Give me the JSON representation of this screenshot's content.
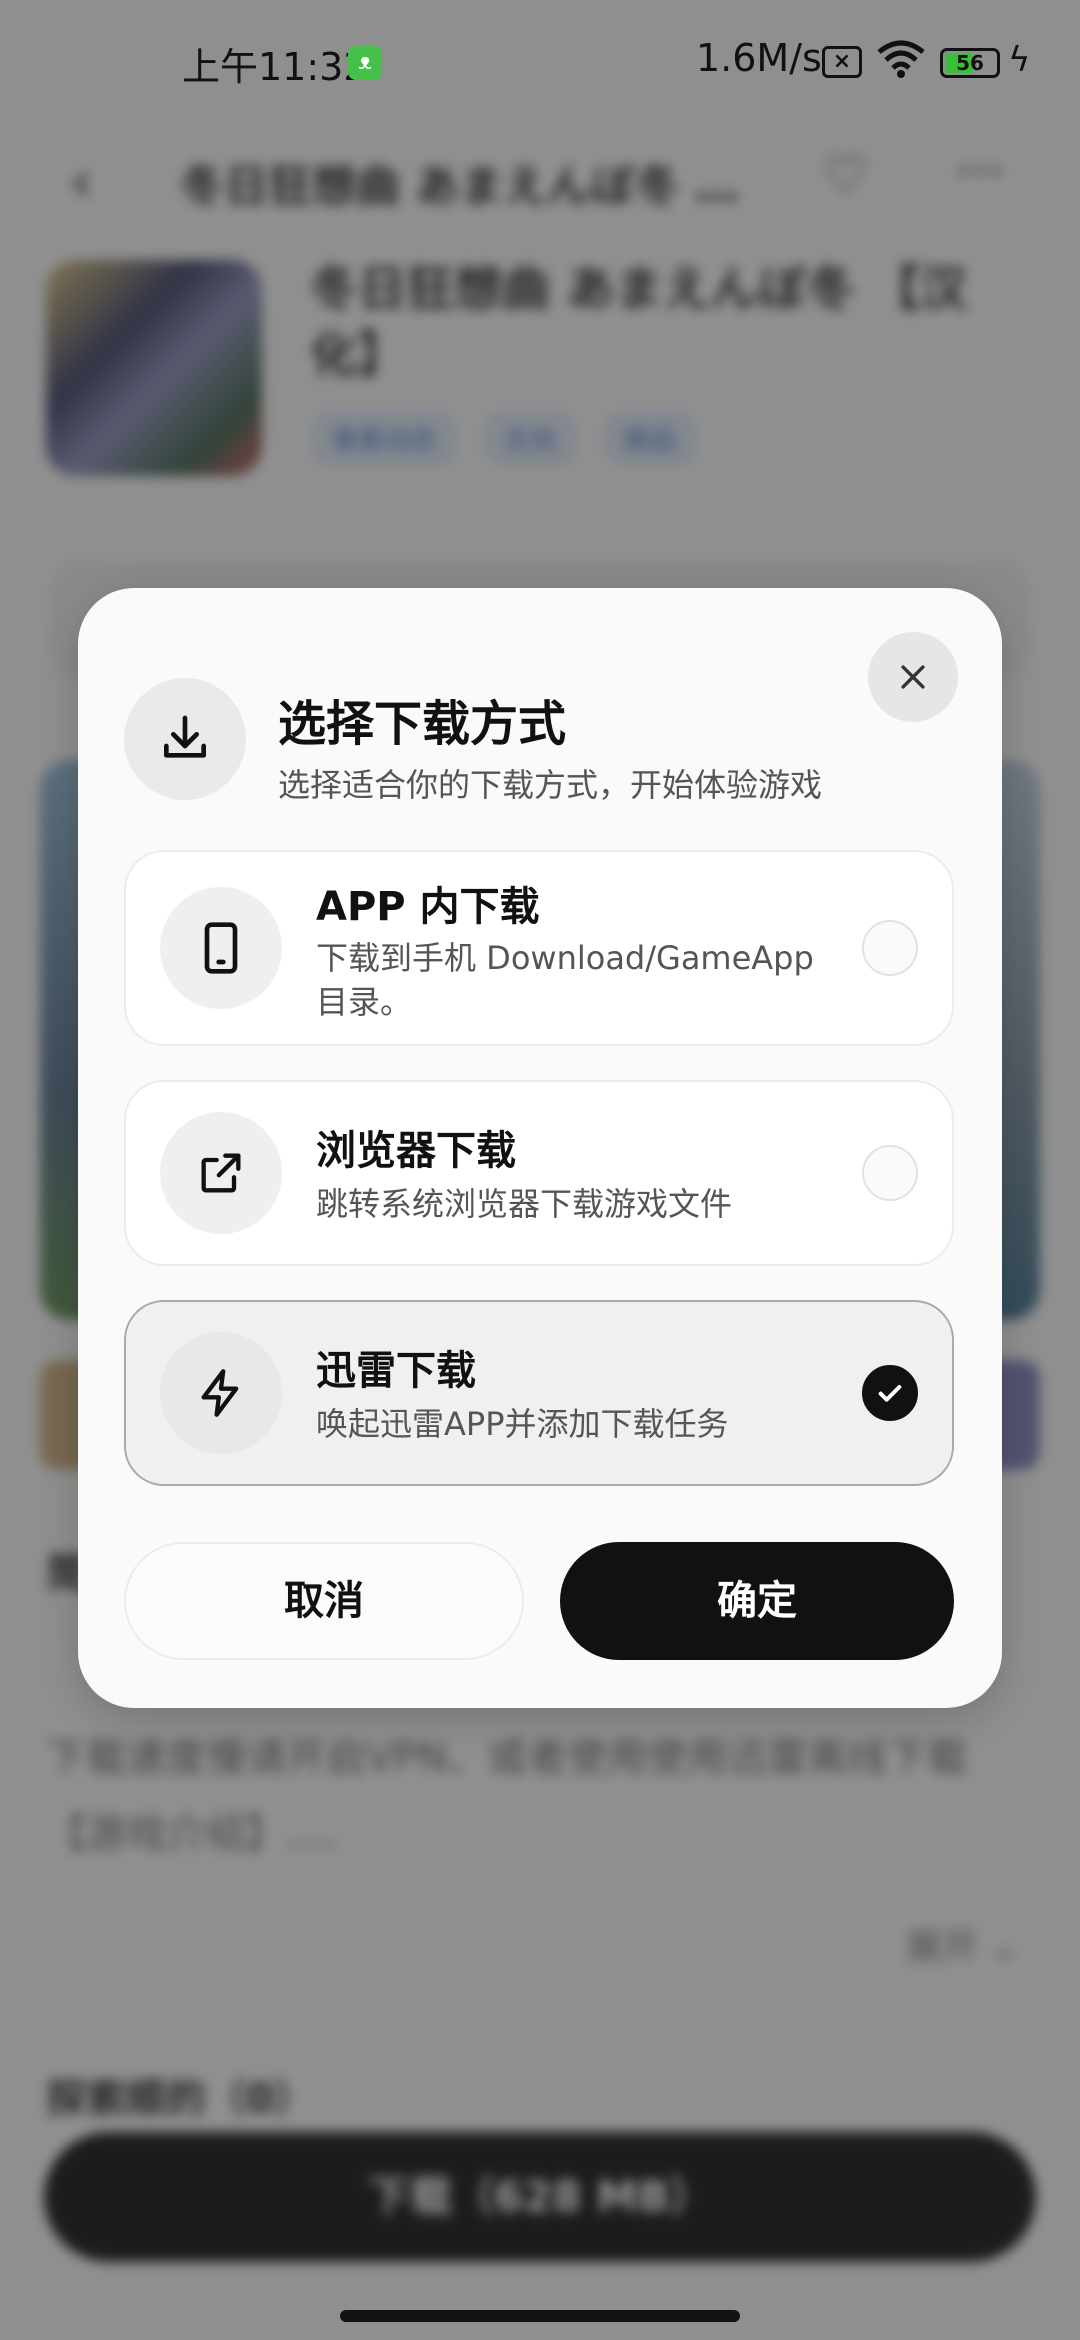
{
  "status_bar": {
    "time": "上午11:32",
    "net_speed": "1.6M/s",
    "battery_level": "56",
    "battery_percent": 56,
    "icons": [
      "cat-app-icon",
      "sim-x-icon",
      "wifi-icon",
      "battery-icon",
      "charging-icon"
    ]
  },
  "background": {
    "nav_title": "冬日狂想曲 あまえんぼ冬 …",
    "game_title": "冬日狂想曲 あまえんぼ冬 【汉化】",
    "tags": [
      "像素动态",
      "文向",
      "精品"
    ],
    "section_title": "简",
    "description": "下载速度慢请开启VPN、或者使用使用迅雷离线下载【游戏介绍】....",
    "expand_label": "展开",
    "related_title": "探索顺的（0）",
    "download_button": "下载（628 MB）"
  },
  "dialog": {
    "title": "选择下载方式",
    "subtitle": "选择适合你的下载方式，开始体验游戏",
    "options": [
      {
        "title": "APP 内下载",
        "desc": "下载到手机 Download/GameApp 目录。",
        "icon": "phone-icon",
        "selected": false
      },
      {
        "title": "浏览器下载",
        "desc": "跳转系统浏览器下载游戏文件",
        "icon": "external-link-icon",
        "selected": false
      },
      {
        "title": "迅雷下载",
        "desc": "唤起迅雷APP并添加下载任务",
        "icon": "lightning-icon",
        "selected": true
      }
    ],
    "cancel_label": "取消",
    "confirm_label": "确定"
  },
  "colors": {
    "accent": "#111111",
    "tag_text": "#4b79c6",
    "battery": "#3bbf3b"
  }
}
